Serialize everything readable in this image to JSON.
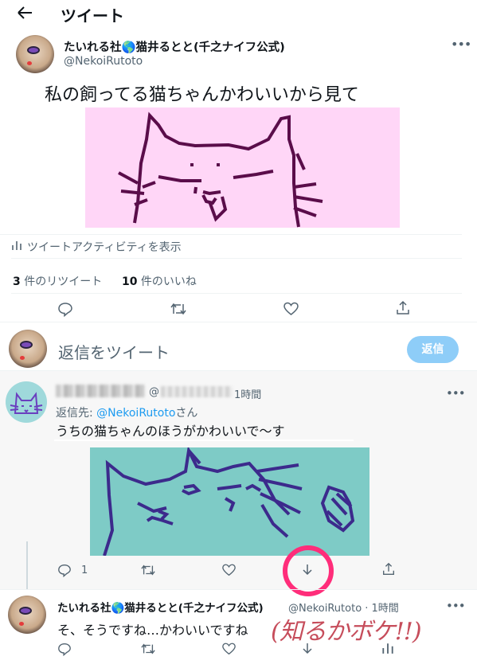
{
  "header": {
    "title": "ツイート"
  },
  "tweet": {
    "name": "たいれる社🌎猫井るとと(千之ナイフ公式)",
    "handle": "@NekoiRutoto",
    "text": "私の飼ってる猫ちゃんかわいいから見て",
    "activity_label": "ツイートアクティビティを表示",
    "retweets": "3",
    "retweets_label": " 件のリツイート",
    "likes": "10",
    "likes_label": " 件のいいね"
  },
  "compose": {
    "placeholder": "返信をツイート",
    "button": "返信"
  },
  "reply1": {
    "at": "@",
    "time": "1時間",
    "reply_to_prefix": "返信先: ",
    "reply_to_handle": "@NekoiRutoto",
    "reply_to_suffix": "さん",
    "text": "うちの猫ちゃんのほうがかわいいで〜す",
    "reply_count": "1"
  },
  "reply2": {
    "name": "たいれる社🌎猫井るとと(千之ナイフ公式)",
    "handle_time": "@NekoiRutoto · 1時間",
    "text": "そ、そうですね…かわいいですね"
  },
  "annotation": {
    "text": "(知るかボケ!!)"
  },
  "colors": {
    "accent": "#1d9bf0",
    "tweet_image_bg": "#ffd6f7",
    "reply_image_bg": "#7ecbc6",
    "annotation": "#ff2d7a"
  },
  "icons": [
    "back-arrow-icon",
    "more-icon",
    "reply-icon",
    "retweet-icon",
    "like-icon",
    "share-icon",
    "bar-chart-icon",
    "download-arrow-icon"
  ]
}
